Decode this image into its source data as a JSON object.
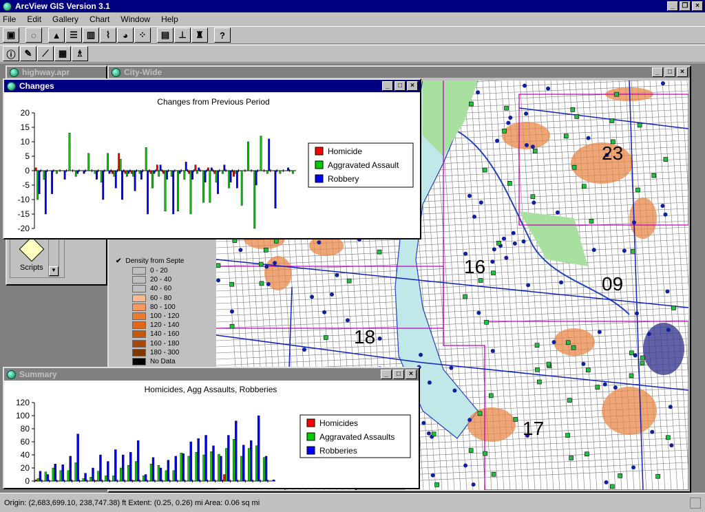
{
  "app": {
    "title": "ArcView GIS Version 3.1"
  },
  "menu": [
    "File",
    "Edit",
    "Gallery",
    "Chart",
    "Window",
    "Help"
  ],
  "windows": {
    "project": {
      "title": "highway.apr"
    },
    "view": {
      "title": "City-Wide"
    },
    "changes": {
      "title": "Changes"
    },
    "summary": {
      "title": "Summary"
    }
  },
  "scripts_label": "Scripts",
  "density_legend": {
    "title": "Density from Septe",
    "classes": [
      {
        "label": "0 - 20",
        "color": "#c0c0c0"
      },
      {
        "label": "20 - 40",
        "color": "#c0c0c0"
      },
      {
        "label": "40 - 60",
        "color": "#c0c0c0"
      },
      {
        "label": "60 - 80",
        "color": "#f8b890"
      },
      {
        "label": "80 - 100",
        "color": "#f49a60"
      },
      {
        "label": "100 - 120",
        "color": "#ee7a30"
      },
      {
        "label": "120 - 140",
        "color": "#e06818"
      },
      {
        "label": "140 - 160",
        "color": "#c85808"
      },
      {
        "label": "160 - 180",
        "color": "#a84808"
      },
      {
        "label": "180 - 300",
        "color": "#803800"
      },
      {
        "label": "No Data",
        "color": "#000000"
      }
    ]
  },
  "map": {
    "district_labels": [
      "23",
      "16",
      "09",
      "18",
      "17"
    ],
    "colors": {
      "water": "#c0e8e8",
      "park": "#a8e0a0",
      "heat": "#e8884a",
      "points_green": "#20c040",
      "points_blue": "#1020a0",
      "districts": "#c000c0",
      "roads": "#1020c0"
    }
  },
  "status_bar": {
    "text": "Origin: (2,683,699.10, 238,747.38) ft  Extent: (0.25, 0.26) mi  Area: 0.06 sq mi"
  },
  "chart_data": [
    {
      "type": "bar",
      "title": "Changes from Previous Period",
      "ylim": [
        -20,
        20
      ],
      "yticks": [
        20,
        15,
        10,
        5,
        0,
        -5,
        -10,
        -15,
        -20
      ],
      "legend_position": "right",
      "series": [
        {
          "name": "Homicide",
          "color": "#ff0000",
          "values": [
            1,
            0,
            0,
            0,
            0,
            0,
            0,
            0,
            0,
            0,
            0,
            0,
            -1,
            6,
            -1,
            -1,
            0,
            0,
            -1,
            2,
            -1,
            0,
            0,
            0,
            -1,
            2,
            0,
            1,
            -1,
            0,
            0,
            -2,
            0,
            0,
            0,
            0,
            0,
            0,
            0,
            0,
            0
          ]
        },
        {
          "name": "Aggravated Assault",
          "color": "#00cc00",
          "values": [
            -10,
            -3,
            0,
            -1,
            0,
            13,
            -2,
            0,
            6,
            -1,
            -4,
            6,
            -2,
            4,
            -2,
            -2,
            -1,
            8,
            -6,
            -2,
            -14,
            -2,
            -14,
            -3,
            -15,
            -1,
            -11,
            -11,
            -4,
            -1,
            -6,
            -1,
            -12,
            10,
            -20,
            12,
            -1,
            0,
            -1,
            0,
            -1
          ]
        },
        {
          "name": "Robbery",
          "color": "#0000ff",
          "values": [
            -8,
            -15,
            -8,
            0,
            -3,
            0,
            -1,
            -1,
            0,
            -3,
            -10,
            -1,
            -6,
            -10,
            -1,
            -7,
            -3,
            -15,
            -1,
            2,
            -3,
            -15,
            -1,
            3,
            -3,
            1,
            -4,
            1,
            -8,
            2,
            -4,
            -6,
            0,
            0,
            -5,
            0,
            11,
            -13,
            0,
            1,
            0
          ]
        }
      ]
    },
    {
      "type": "bar",
      "title": "Homicides, Agg Assaults, Robberies",
      "ylim": [
        0,
        120
      ],
      "yticks": [
        120,
        100,
        80,
        60,
        40,
        20,
        0
      ],
      "legend_position": "right",
      "series": [
        {
          "name": "Homicides",
          "color": "#ff0000",
          "values": [
            2,
            0,
            0,
            0,
            0,
            0,
            0,
            0,
            1,
            0,
            0,
            0,
            0,
            1,
            0,
            0,
            0,
            0,
            0,
            0,
            0,
            0,
            0,
            0,
            0,
            10,
            0,
            0,
            0,
            0,
            0,
            0
          ]
        },
        {
          "name": "Aggravated Assaults",
          "color": "#00cc00",
          "values": [
            4,
            14,
            20,
            16,
            16,
            28,
            4,
            6,
            15,
            8,
            8,
            20,
            24,
            30,
            8,
            26,
            24,
            16,
            16,
            43,
            38,
            44,
            40,
            45,
            41,
            50,
            64,
            38,
            50,
            54,
            36,
            0
          ]
        },
        {
          "name": "Robberies",
          "color": "#0000ff",
          "values": [
            15,
            10,
            26,
            25,
            38,
            72,
            12,
            20,
            40,
            30,
            48,
            40,
            44,
            62,
            10,
            36,
            20,
            32,
            38,
            42,
            60,
            65,
            70,
            54,
            38,
            70,
            92,
            55,
            62,
            100,
            38,
            2
          ]
        }
      ]
    }
  ]
}
